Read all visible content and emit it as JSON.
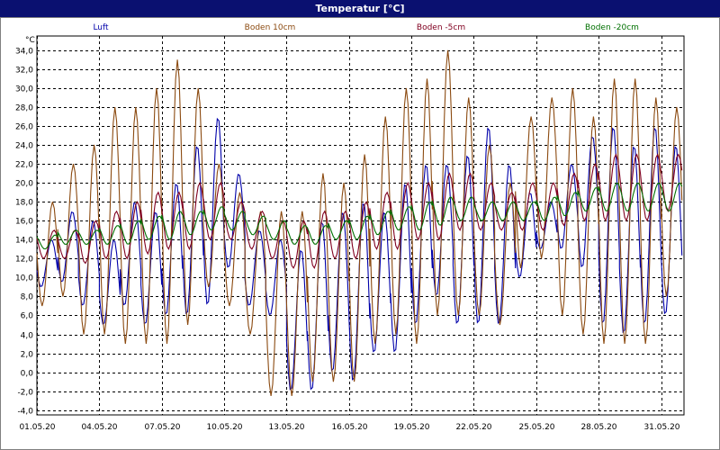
{
  "window": {
    "title": "Temperatur [°C]"
  },
  "chart_data": {
    "type": "line",
    "title": "Temperatur [°C]",
    "ylabel": "°C",
    "ylim": [
      -4.5,
      35.5
    ],
    "yticks": [
      -4.0,
      -2.0,
      0.0,
      2.0,
      4.0,
      6.0,
      8.0,
      10.0,
      12.0,
      14.0,
      16.0,
      18.0,
      20.0,
      22.0,
      24.0,
      26.0,
      28.0,
      30.0,
      32.0,
      34.0
    ],
    "ytick_labels": [
      "-4,0",
      "-2,0",
      "0,0",
      "2,0",
      "4,0",
      "6,0",
      "8,0",
      "10,0",
      "12,0",
      "14,0",
      "16,0",
      "18,0",
      "20,0",
      "22,0",
      "24,0",
      "26,0",
      "28,0",
      "30,0",
      "32,0",
      "34,0"
    ],
    "xlim_days": [
      1,
      32.1
    ],
    "xticks_labels": [
      "01.05.20",
      "04.05.20",
      "07.05.20",
      "10.05.20",
      "13.05.20",
      "16.05.20",
      "19.05.20",
      "22.05.20",
      "25.05.20",
      "28.05.20",
      "31.05.20"
    ],
    "xticks_day": [
      1,
      4,
      7,
      10,
      13,
      16,
      19,
      22,
      25,
      28,
      31
    ],
    "grid": true,
    "legend_position": "top",
    "series": [
      {
        "name": "Luft",
        "color": "#0000aa",
        "daily_min": [
          9,
          9.5,
          7,
          5,
          7,
          5,
          6,
          6,
          7,
          11,
          7,
          6,
          -2,
          -2,
          0,
          -1,
          2,
          2,
          5,
          8,
          5,
          5,
          5,
          10,
          13,
          13,
          11,
          5,
          4,
          5,
          6
        ],
        "daily_max": [
          14,
          17,
          16,
          14,
          18,
          17,
          20,
          24,
          27,
          21,
          15,
          14,
          13,
          16,
          17,
          18,
          17,
          20,
          22,
          22,
          23,
          26,
          22,
          19,
          18,
          22,
          25,
          26,
          24,
          26,
          24
        ]
      },
      {
        "name": "Boden 10cm",
        "color": "#8b4a10",
        "daily_min": [
          7,
          8,
          4,
          4,
          3,
          3,
          3,
          5,
          9,
          7,
          4,
          -2.5,
          -2.5,
          -1,
          -1,
          -1,
          3,
          4,
          3,
          6,
          6,
          6,
          5,
          11,
          12,
          6,
          4,
          3,
          3,
          3,
          8
        ],
        "daily_max": [
          18,
          22,
          24,
          28,
          28,
          30,
          33,
          30,
          22,
          19,
          17,
          17,
          17,
          21,
          20,
          23,
          27,
          30,
          31,
          34,
          29,
          24,
          20,
          27,
          29,
          30,
          27,
          31,
          31,
          29,
          28
        ]
      },
      {
        "name": "Boden -5cm",
        "color": "#800020",
        "daily_min": [
          12,
          12,
          11.5,
          12,
          12,
          12.5,
          13,
          13,
          14,
          14,
          13,
          12,
          11,
          11,
          12,
          12,
          13,
          13,
          14,
          14,
          15,
          15,
          15,
          15,
          15,
          15.5,
          16,
          16,
          16,
          16,
          17
        ],
        "daily_max": [
          15,
          15,
          16,
          17,
          18,
          19,
          19,
          20,
          20,
          18,
          17,
          16,
          16,
          17,
          17,
          18,
          19,
          20,
          20,
          21,
          21,
          20,
          19,
          20,
          20,
          21,
          22,
          23,
          23,
          23,
          23
        ]
      },
      {
        "name": "Boden -20cm",
        "color": "#007000",
        "daily_min": [
          13,
          13.5,
          13.5,
          13.5,
          13.5,
          14,
          14,
          14.5,
          15,
          15,
          14.5,
          14,
          13.5,
          13.5,
          14,
          14,
          14.5,
          15,
          15,
          15.5,
          16,
          16,
          16,
          16,
          16,
          16.5,
          17,
          17,
          17,
          17,
          17
        ],
        "daily_max": [
          14.5,
          15,
          15,
          15.5,
          16,
          16.5,
          17,
          17,
          17.5,
          17,
          16.5,
          16,
          15.5,
          15.5,
          16,
          16.5,
          17,
          17.5,
          18,
          18.5,
          18.5,
          18,
          18,
          18,
          18.5,
          19,
          19.5,
          20,
          20,
          20,
          20
        ]
      }
    ]
  }
}
